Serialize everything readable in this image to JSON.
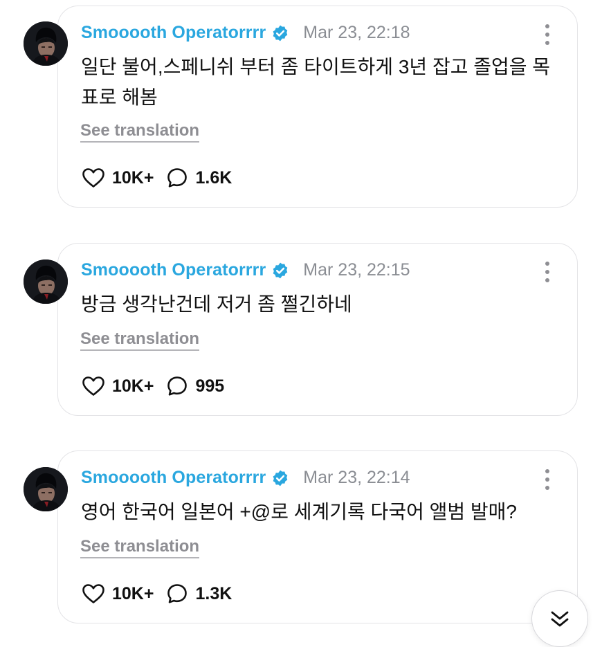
{
  "posts": [
    {
      "username": "Smooooth Operatorrrr",
      "timestamp": "Mar 23, 22:18",
      "text": "일단 불어,스페니쉬 부터 좀 타이트하게 3년 잡고 졸업을 목표로 해봄",
      "translate_label": "See translation",
      "likes": "10K+",
      "replies": "1.6K"
    },
    {
      "username": "Smooooth Operatorrrr",
      "timestamp": "Mar 23, 22:15",
      "text": "방금 생각난건데 저거 좀 쩔긴하네",
      "translate_label": "See translation",
      "likes": "10K+",
      "replies": "995"
    },
    {
      "username": "Smooooth Operatorrrr",
      "timestamp": "Mar 23, 22:14",
      "text": "영어 한국어 일본어 +@로 세계기록 다국어 앨범 발매?",
      "translate_label": "See translation",
      "likes": "10K+",
      "replies": "1.3K"
    }
  ],
  "icons": {
    "verified": "verified-badge-icon",
    "menu": "more-vertical-icon",
    "like": "heart-outline-icon",
    "reply": "speech-bubble-icon",
    "scroll": "chevrons-down-icon"
  },
  "colors": {
    "username": "#2aa7df",
    "verified_badge": "#2aa7df",
    "timestamp": "#8a8d93",
    "secondary": "#8e8e93",
    "card_border": "#e3e3e6"
  }
}
